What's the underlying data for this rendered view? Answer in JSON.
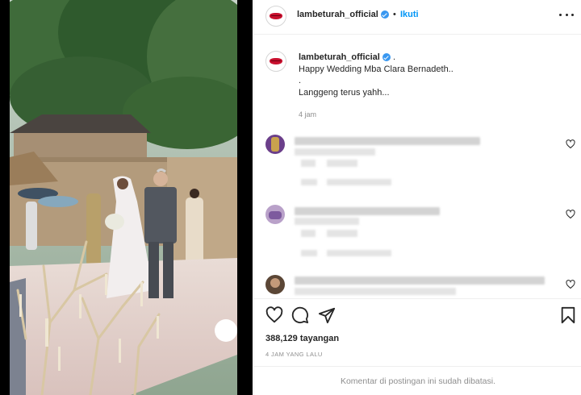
{
  "post": {
    "username": "lambeturah_official",
    "separator": "•",
    "follow_label": "Ikuti"
  },
  "caption": {
    "username": "lambeturah_official",
    "suffix": ".",
    "line1": "Happy Wedding Mba Clara Bernadeth..",
    "line2": ".",
    "line3": "Langgeng terus yahh...",
    "time": "4 jam"
  },
  "stats": {
    "views": "388,129 tayangan",
    "time_ago": "4 JAM YANG LALU"
  },
  "footer": {
    "comments_disabled": "Komentar di postingan ini sudah dibatasi."
  },
  "icons": {
    "verified": "verified-badge-icon",
    "more": "more-options-icon",
    "like": "heart-icon",
    "comment": "comment-icon",
    "share": "share-icon",
    "save": "bookmark-icon"
  },
  "colors": {
    "link_blue": "#0095f6",
    "verified_blue": "#3897f0",
    "brand_red": "#c8102e",
    "muted_gray": "#8e8e8e"
  }
}
